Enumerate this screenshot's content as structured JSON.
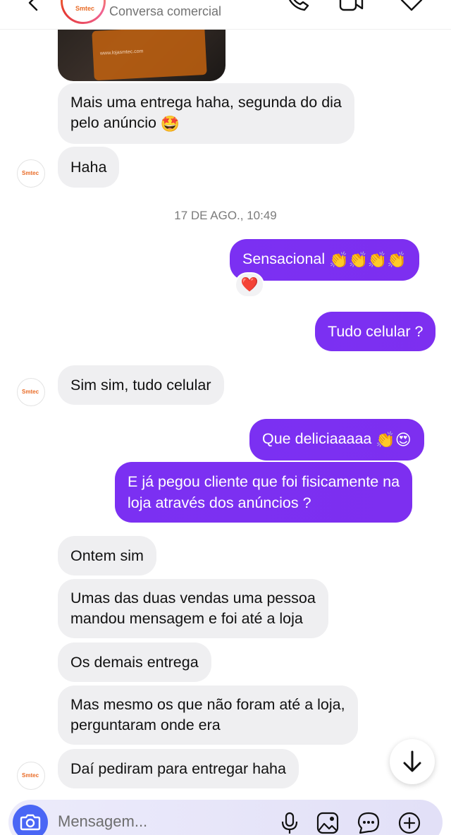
{
  "header": {
    "subtitle": "Conversa comercial",
    "avatar_logo": "Smtec"
  },
  "media": {
    "card_text": "www.lojasmtec.com"
  },
  "messages": [
    {
      "text": "Mais uma entrega haha, segunda do dia",
      "text2": "pelo anúncio",
      "emoji": "🤩"
    },
    {
      "text": "Haha"
    },
    {
      "text": "Sensacional",
      "emoji": "👏👏👏👏"
    },
    {
      "text": "Tudo celular ?"
    },
    {
      "text": "Sim sim, tudo celular"
    },
    {
      "text": "Que deliciaaaaa",
      "emoji": "👏😍"
    },
    {
      "text": "E já pegou cliente que foi fisicamente na",
      "text2": "loja através dos anúncios ?"
    },
    {
      "text": "Ontem sim"
    },
    {
      "text": "Umas das duas vendas uma pessoa",
      "text2": "mandou mensagem e foi até a loja"
    },
    {
      "text": "Os demais entrega"
    },
    {
      "text": "Mas mesmo os que não foram até a loja,",
      "text2": "perguntaram onde era"
    },
    {
      "text": "Daí pediram para entregar haha"
    }
  ],
  "timestamp": "17 DE AGO., 10:49",
  "reaction": "❤️",
  "avatar_label": "Smtec",
  "composer": {
    "placeholder": "Mensagem..."
  }
}
